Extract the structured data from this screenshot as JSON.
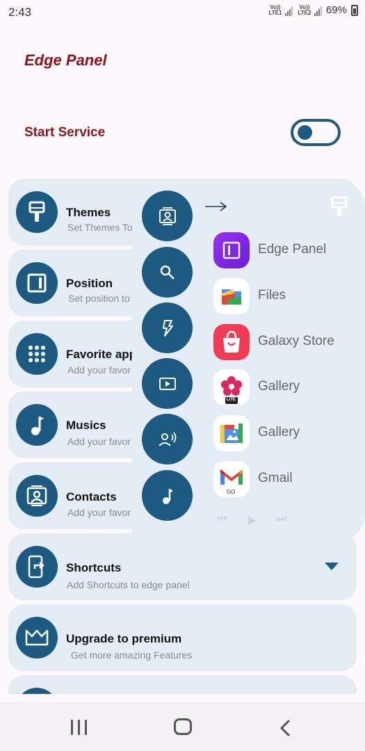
{
  "status_bar": {
    "time": "2:43",
    "sim1_label": "Vo)) LTE1",
    "sim2_label": "Vo)) LTE2",
    "battery": "69%"
  },
  "app": {
    "title": "Edge Panel"
  },
  "service": {
    "label": "Start Service",
    "enabled": false
  },
  "menu": {
    "themes": {
      "title": "Themes",
      "subtitle": "Set Themes To",
      "icon": "paint-brush-icon"
    },
    "position": {
      "title": "Position",
      "subtitle": "Set position to",
      "icon": "side-panel-icon"
    },
    "favorite_apps": {
      "title": "Favorite app",
      "subtitle": "Add your favor",
      "icon": "apps-grid-icon"
    },
    "musics": {
      "title": "Musics",
      "subtitle": "Add your favor",
      "icon": "music-note-icon"
    },
    "contacts": {
      "title": "Contacts",
      "subtitle": "Add your favor",
      "icon": "contact-card-icon"
    },
    "shortcuts": {
      "title": "Shortcuts",
      "subtitle": "Add Shortcuts to edge panel",
      "icon": "phone-share-icon"
    },
    "premium": {
      "title": "Upgrade to premium",
      "subtitle": "Get more amazing Features",
      "icon": "crown-icon"
    }
  },
  "edge_panel": {
    "side_buttons": [
      "contacts-icon",
      "search-icon",
      "flash-icon",
      "video-icon",
      "voice-icon",
      "music-icon"
    ],
    "apps": [
      {
        "label": "Edge Panel",
        "icon": "edge-panel-app-icon"
      },
      {
        "label": "Files",
        "icon": "files-app-icon"
      },
      {
        "label": "Galaxy Store",
        "icon": "galaxy-store-app-icon"
      },
      {
        "label": "Gallery",
        "icon": "gallery-lite-app-icon",
        "badge": "LITE"
      },
      {
        "label": "Gallery",
        "icon": "gallery-app-icon"
      },
      {
        "label": "Gmail",
        "icon": "gmail-go-app-icon",
        "badge": "GO"
      }
    ]
  },
  "colors": {
    "primary": "#1c5a82",
    "accent": "#8b1418",
    "card_bg": "#e4edf5"
  }
}
